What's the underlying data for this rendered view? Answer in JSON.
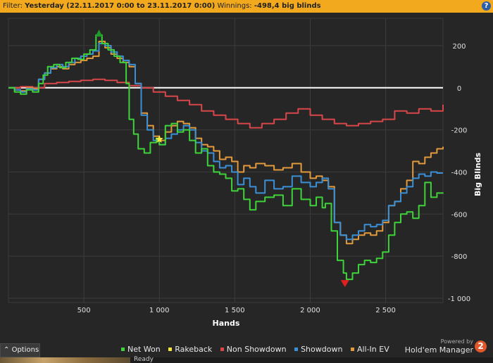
{
  "filter": {
    "label": "Filter:",
    "value": "Yesterday (22.11.2017 0:00 to 23.11.2017 0:00)",
    "winnings_label": "Winnings:",
    "winnings_value": "-498,4 big blinds"
  },
  "help_icon": "?",
  "options_label": "Options",
  "powered_by": "Powered by",
  "brand": "Hold'em Manager",
  "brand_badge": "2",
  "status": "Ready",
  "colors": {
    "net_won": "#3fd33a",
    "rakeback": "#f5e63a",
    "non_showdown": "#d9464a",
    "showdown": "#3a8fd6",
    "all_in_ev": "#e39a3c",
    "zero_line": "#ffffff",
    "max_marker": "#1f9a2a",
    "min_marker": "#e02020"
  },
  "chart_data": {
    "type": "line",
    "xlabel": "Hands",
    "ylabel": "Big Blinds",
    "xlim": [
      0,
      2880
    ],
    "ylim": [
      -1020,
      330
    ],
    "x_ticks": [
      500,
      1000,
      1500,
      2000,
      2500
    ],
    "x_tick_labels": [
      "500",
      "1 000",
      "1 500",
      "2 000",
      "2 500"
    ],
    "y_ticks": [
      200,
      0,
      -200,
      -400,
      -600,
      -800,
      -1000
    ],
    "y_tick_labels": [
      "200",
      "0",
      "-200",
      "-400",
      "-600",
      "-800",
      "-1 000"
    ],
    "grid": true,
    "legend_position": "bottom",
    "series": [
      {
        "name": "Net Won",
        "key": "net_won",
        "x": [
          0,
          40,
          80,
          120,
          160,
          200,
          230,
          260,
          300,
          340,
          380,
          420,
          460,
          500,
          540,
          580,
          600,
          620,
          660,
          700,
          740,
          780,
          800,
          830,
          860,
          900,
          940,
          980,
          1000,
          1040,
          1080,
          1120,
          1160,
          1200,
          1240,
          1280,
          1320,
          1360,
          1400,
          1440,
          1480,
          1520,
          1560,
          1600,
          1640,
          1700,
          1760,
          1820,
          1880,
          1940,
          2000,
          2040,
          2080,
          2100,
          2140,
          2180,
          2220,
          2240,
          2280,
          2320,
          2360,
          2400,
          2440,
          2480,
          2520,
          2560,
          2600,
          2640,
          2680,
          2720,
          2760,
          2800,
          2840,
          2880
        ],
        "y": [
          0,
          -20,
          -30,
          -10,
          -20,
          20,
          60,
          100,
          110,
          95,
          120,
          140,
          135,
          160,
          180,
          250,
          250,
          210,
          180,
          150,
          120,
          20,
          -150,
          -220,
          -290,
          -310,
          -260,
          -240,
          -270,
          -180,
          -170,
          -210,
          -200,
          -250,
          -310,
          -290,
          -370,
          -400,
          -410,
          -430,
          -490,
          -480,
          -530,
          -580,
          -540,
          -520,
          -510,
          -560,
          -480,
          -530,
          -560,
          -520,
          -570,
          -550,
          -680,
          -820,
          -880,
          -910,
          -880,
          -840,
          -820,
          -830,
          -810,
          -780,
          -700,
          -640,
          -600,
          -590,
          -620,
          -560,
          -450,
          -520,
          -500,
          -498
        ]
      },
      {
        "name": "Rakeback",
        "key": "rakeback",
        "x": [
          0,
          2880
        ],
        "y": [
          0,
          0
        ],
        "visible_as_zero": true
      },
      {
        "name": "Non Showdown",
        "key": "non_showdown",
        "x": [
          0,
          80,
          160,
          240,
          320,
          400,
          480,
          560,
          640,
          720,
          800,
          880,
          960,
          1040,
          1120,
          1200,
          1280,
          1360,
          1440,
          1520,
          1600,
          1680,
          1760,
          1840,
          1920,
          2000,
          2080,
          2160,
          2240,
          2320,
          2400,
          2480,
          2560,
          2640,
          2720,
          2800,
          2880
        ],
        "y": [
          0,
          5,
          0,
          20,
          25,
          30,
          35,
          40,
          35,
          25,
          10,
          0,
          -20,
          -40,
          -60,
          -80,
          -110,
          -130,
          -150,
          -170,
          -190,
          -170,
          -150,
          -120,
          -100,
          -130,
          -150,
          -170,
          -180,
          -170,
          -160,
          -150,
          -110,
          -120,
          -100,
          -110,
          -80
        ]
      },
      {
        "name": "Showdown",
        "key": "showdown",
        "x": [
          0,
          40,
          80,
          120,
          160,
          200,
          240,
          280,
          320,
          360,
          400,
          440,
          480,
          520,
          560,
          600,
          640,
          680,
          720,
          760,
          800,
          840,
          880,
          920,
          960,
          1000,
          1040,
          1080,
          1120,
          1160,
          1200,
          1240,
          1280,
          1320,
          1360,
          1400,
          1440,
          1480,
          1520,
          1560,
          1600,
          1640,
          1700,
          1760,
          1820,
          1880,
          1940,
          2000,
          2040,
          2080,
          2120,
          2160,
          2200,
          2240,
          2280,
          2320,
          2360,
          2400,
          2440,
          2480,
          2520,
          2560,
          2600,
          2640,
          2680,
          2720,
          2760,
          2800,
          2840,
          2880
        ],
        "y": [
          0,
          -10,
          -20,
          -5,
          -10,
          40,
          70,
          95,
          110,
          100,
          120,
          140,
          150,
          160,
          175,
          210,
          200,
          170,
          150,
          130,
          110,
          20,
          -130,
          -200,
          -250,
          -270,
          -240,
          -220,
          -200,
          -180,
          -200,
          -260,
          -300,
          -310,
          -350,
          -380,
          -370,
          -400,
          -460,
          -430,
          -470,
          -500,
          -440,
          -480,
          -470,
          -420,
          -450,
          -470,
          -450,
          -430,
          -480,
          -640,
          -700,
          -720,
          -700,
          -680,
          -650,
          -660,
          -650,
          -630,
          -560,
          -540,
          -500,
          -470,
          -430,
          -410,
          -420,
          -400,
          -405,
          -405
        ]
      },
      {
        "name": "All-In EV",
        "key": "all_in_ev",
        "x": [
          0,
          40,
          80,
          120,
          160,
          200,
          240,
          280,
          320,
          360,
          400,
          440,
          480,
          520,
          560,
          600,
          640,
          680,
          720,
          760,
          800,
          840,
          880,
          920,
          960,
          1000,
          1040,
          1080,
          1120,
          1160,
          1200,
          1240,
          1280,
          1320,
          1360,
          1400,
          1440,
          1480,
          1520,
          1560,
          1600,
          1640,
          1700,
          1760,
          1820,
          1880,
          1940,
          2000,
          2040,
          2080,
          2120,
          2160,
          2200,
          2240,
          2280,
          2320,
          2360,
          2400,
          2440,
          2480,
          2520,
          2560,
          2600,
          2640,
          2680,
          2720,
          2760,
          2800,
          2840,
          2880
        ],
        "y": [
          0,
          -10,
          -15,
          0,
          -5,
          40,
          70,
          90,
          100,
          90,
          110,
          120,
          130,
          140,
          150,
          220,
          190,
          160,
          140,
          120,
          100,
          20,
          -120,
          -180,
          -230,
          -250,
          -210,
          -180,
          -160,
          -170,
          -190,
          -240,
          -270,
          -280,
          -300,
          -340,
          -330,
          -350,
          -400,
          -370,
          -380,
          -360,
          -370,
          -390,
          -380,
          -360,
          -400,
          -430,
          -420,
          -440,
          -470,
          -640,
          -700,
          -740,
          -720,
          -700,
          -690,
          -700,
          -680,
          -640,
          -560,
          -540,
          -480,
          -440,
          -350,
          -360,
          -330,
          -310,
          -290,
          -280
        ]
      }
    ],
    "markers": [
      {
        "type": "max",
        "shape": "triangle-up",
        "x": 600,
        "y": 260
      },
      {
        "type": "min",
        "shape": "triangle-down",
        "x": 2230,
        "y": -930
      },
      {
        "type": "star",
        "shape": "star",
        "x": 1000,
        "y": -245
      }
    ]
  }
}
